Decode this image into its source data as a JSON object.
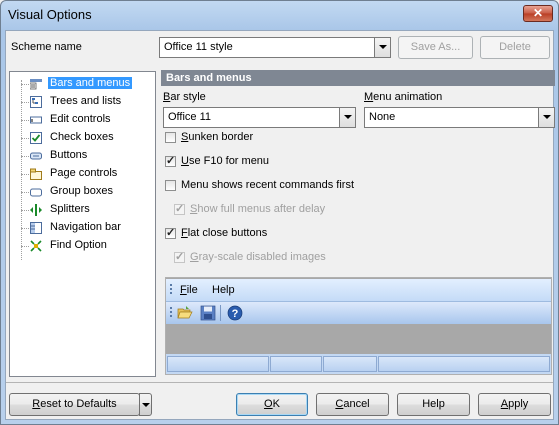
{
  "window": {
    "title": "Visual Options",
    "close_glyph": "✕"
  },
  "scheme": {
    "label": "Scheme name",
    "value": "Office 11 style",
    "save_as": "Save As...",
    "delete": "Delete"
  },
  "tree": {
    "items": [
      {
        "label": "Bars and menus",
        "icon": "bars-menus-icon",
        "selected": true
      },
      {
        "label": "Trees and lists",
        "icon": "tree-list-icon"
      },
      {
        "label": "Edit controls",
        "icon": "edit-control-icon"
      },
      {
        "label": "Check boxes",
        "icon": "checkbox-icon"
      },
      {
        "label": "Buttons",
        "icon": "button-icon"
      },
      {
        "label": "Page controls",
        "icon": "page-control-icon"
      },
      {
        "label": "Group boxes",
        "icon": "group-box-icon"
      },
      {
        "label": "Splitters",
        "icon": "splitter-icon"
      },
      {
        "label": "Navigation bar",
        "icon": "navigation-bar-icon"
      },
      {
        "label": "Find Option",
        "icon": "find-option-icon"
      }
    ]
  },
  "panel": {
    "header": "Bars and menus",
    "bar_style": {
      "label_u": "B",
      "label_rest": "ar style",
      "value": "Office 11"
    },
    "menu_animation": {
      "label_u": "M",
      "label_rest": "enu animation",
      "value": "None"
    },
    "options": [
      {
        "u": "S",
        "rest": "unken border",
        "checked": false,
        "enabled": true
      },
      {
        "u": "U",
        "rest": "se F10 for menu",
        "checked": true,
        "enabled": true
      },
      {
        "u": "",
        "rest": "Menu shows recent commands first",
        "checked": false,
        "enabled": true
      },
      {
        "u": "S",
        "rest": "how full menus after delay",
        "checked": true,
        "enabled": false
      },
      {
        "u": "F",
        "rest": "lat close buttons",
        "checked": true,
        "enabled": true
      },
      {
        "u": "G",
        "rest": "ray-scale disabled images",
        "checked": true,
        "enabled": false
      }
    ],
    "preview": {
      "menu": [
        {
          "u": "F",
          "rest": "ile"
        },
        {
          "u": "",
          "rest": "Help"
        }
      ],
      "toolbar_icons": [
        "open-folder-icon",
        "save-icon",
        "help-icon"
      ]
    }
  },
  "footer": {
    "reset_u": "R",
    "reset_rest": "eset to Defaults",
    "ok_u": "O",
    "ok_rest": "K",
    "cancel_u": "C",
    "cancel_rest": "ancel",
    "help": "Help",
    "apply_u": "A",
    "apply_rest": "pply"
  },
  "colors": {
    "selection": "#3399ff",
    "panel_header": "#7f8793",
    "title_bar": "#b8d0ec"
  }
}
